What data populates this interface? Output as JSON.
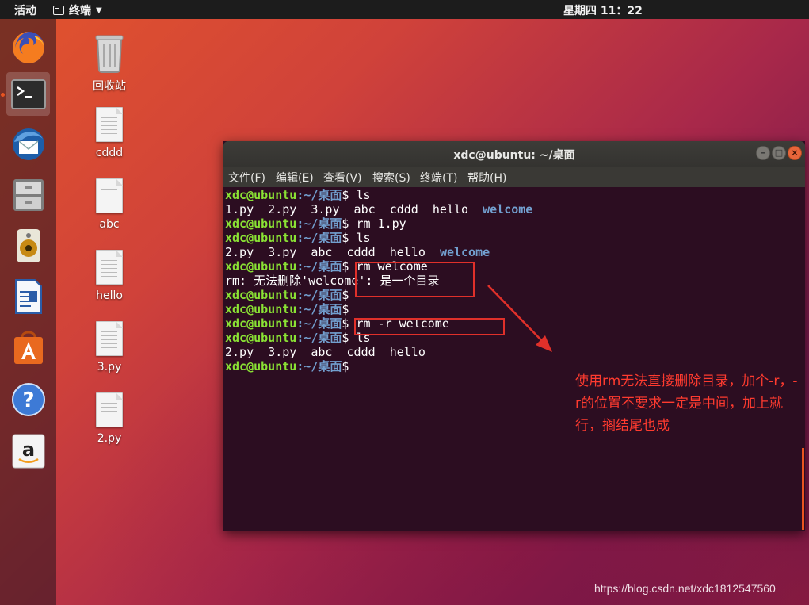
{
  "topbar": {
    "activities": "活动",
    "app_menu": "终端",
    "clock": "星期四 11：22"
  },
  "dock": {
    "items": [
      "firefox-icon",
      "terminal-icon",
      "thunderbird-icon",
      "files-icon",
      "rhythmbox-icon",
      "libreoffice-writer-icon",
      "software-center-icon",
      "help-icon",
      "amazon-icon"
    ],
    "accent": "#e95420"
  },
  "desktop": {
    "icons": [
      {
        "label": "回收站"
      },
      {
        "label": "cddd"
      },
      {
        "label": "abc"
      },
      {
        "label": "hello"
      },
      {
        "label": "3.py"
      },
      {
        "label": "2.py"
      }
    ]
  },
  "terminal": {
    "title": "xdc@ubuntu: ~/桌面",
    "menu": [
      "文件(F)",
      "编辑(E)",
      "查看(V)",
      "搜索(S)",
      "终端(T)",
      "帮助(H)"
    ],
    "prompt_user": "xdc@ubuntu",
    "prompt_path": ":~/桌面",
    "lines": [
      {
        "type": "prompt",
        "cmd": "$ ls"
      },
      {
        "type": "out",
        "text": "1.py  2.py  3.py  abc  cddd  hello  ",
        "dir": "welcome"
      },
      {
        "type": "prompt",
        "cmd": "$ rm 1.py"
      },
      {
        "type": "prompt",
        "cmd": "$ ls"
      },
      {
        "type": "out",
        "text": "2.py  3.py  abc  cddd  hello  ",
        "dir": "welcome"
      },
      {
        "type": "prompt",
        "cmd": "$ rm welcome"
      },
      {
        "type": "out",
        "text": "rm: 无法删除'welcome': 是一个目录",
        "dir": ""
      },
      {
        "type": "prompt",
        "cmd": "$"
      },
      {
        "type": "prompt",
        "cmd": "$"
      },
      {
        "type": "prompt",
        "cmd": "$ rm -r welcome"
      },
      {
        "type": "prompt",
        "cmd": "$ ls"
      },
      {
        "type": "out",
        "text": "2.py  3.py  abc  cddd  hello",
        "dir": ""
      },
      {
        "type": "prompt",
        "cmd": "$"
      }
    ]
  },
  "annotation": {
    "note": "使用rm无法直接删除目录，加个-r，-r的位置不要求一定是中间，加上就行，搁结尾也成",
    "color": "#e0302a"
  },
  "watermark": "https://blog.csdn.net/xdc1812547560"
}
